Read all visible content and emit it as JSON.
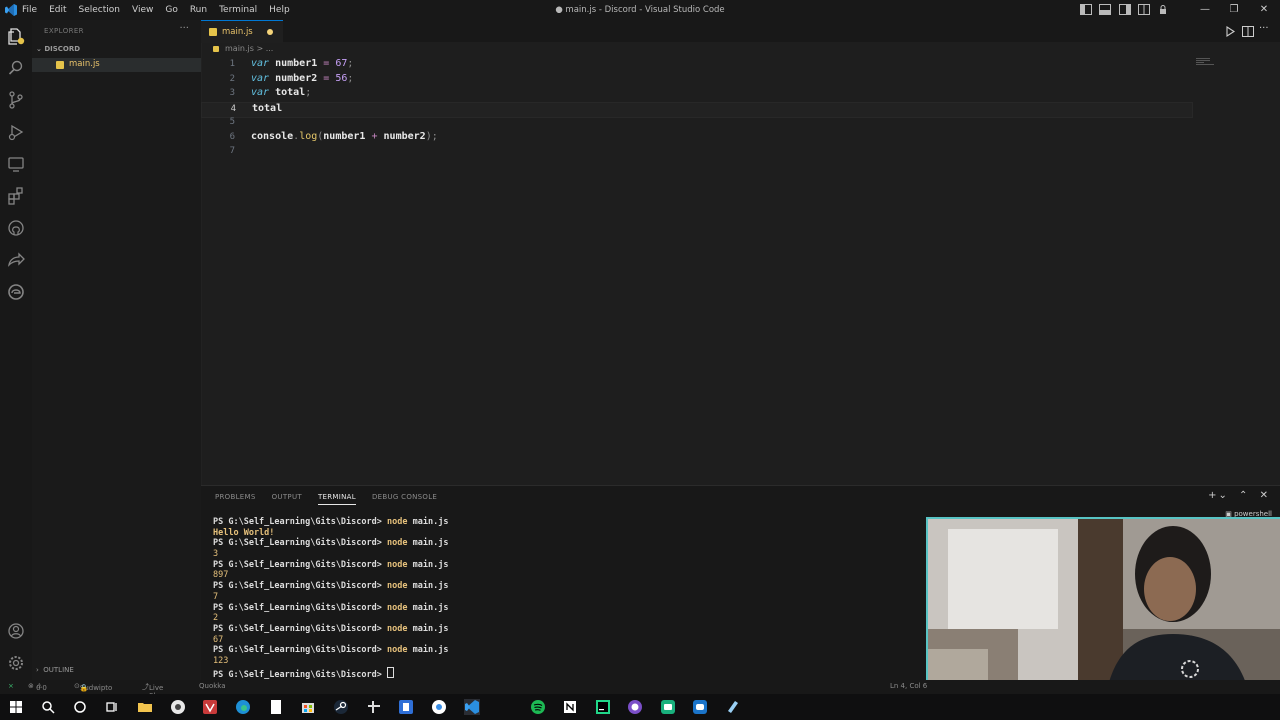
{
  "window": {
    "title": "● main.js - Discord - Visual Studio Code"
  },
  "menu": [
    "File",
    "Edit",
    "Selection",
    "View",
    "Go",
    "Run",
    "Terminal",
    "Help"
  ],
  "sidebar": {
    "header": "EXPLORER",
    "folder": "DISCORD",
    "files": [
      {
        "name": "main.js"
      }
    ],
    "outline": "OUTLINE"
  },
  "editor": {
    "tab_label": "main.js",
    "breadcrumb": "main.js > ...",
    "line_numbers": [
      "1",
      "2",
      "3",
      "4",
      "5",
      "6",
      "7"
    ],
    "lines": [
      {
        "kw": "var",
        "name": "number1",
        "op": "=",
        "num": "67",
        "end": ";"
      },
      {
        "kw": "var",
        "name": "number2",
        "op": "=",
        "num": "56",
        "end": ";"
      },
      {
        "kw": "var",
        "name": "total",
        "end": ";"
      },
      {
        "text": "total"
      },
      {
        "text": ""
      },
      {
        "obj": "console",
        "dot": ".",
        "fn": "log",
        "open": "(",
        "a": "number1",
        "op": "+",
        "b": "number2",
        "close": ");"
      },
      {
        "text": ""
      }
    ]
  },
  "panel": {
    "tabs": [
      "PROBLEMS",
      "OUTPUT",
      "TERMINAL",
      "DEBUG CONSOLE"
    ],
    "active_tab": "TERMINAL",
    "shell_name": "powershell",
    "prompt": "PS G:\\Self_Learning\\Gits\\Discord>",
    "cmd": "node",
    "arg": "main.js",
    "outputs": [
      "Hello World!",
      "3",
      "897",
      "7",
      "2",
      "67",
      "123"
    ]
  },
  "status": {
    "errors": "0",
    "warnings": "0",
    "user": "Sudwipto",
    "live_share": "Live Share",
    "quokka": "Quokka",
    "position": "Ln 4, Col 6"
  },
  "colors": {
    "accent": "#0078d4",
    "js_badge": "#e5c34a",
    "keyword": "#62c0e0",
    "number": "#c6a0f6",
    "terminal_output": "#e5c07b"
  }
}
